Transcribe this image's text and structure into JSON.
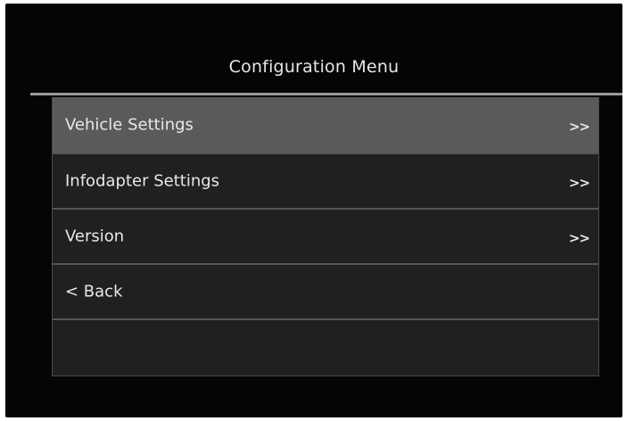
{
  "title": "Configuration Menu",
  "menu": {
    "items": [
      {
        "label": "Vehicle Settings",
        "arrow": ">>"
      },
      {
        "label": "Infodapter Settings",
        "arrow": ">>"
      },
      {
        "label": "Version",
        "arrow": ">>"
      },
      {
        "label": "< Back",
        "arrow": ""
      }
    ]
  },
  "colors": {
    "screen_background": "#050505",
    "row_background": "#202020",
    "selected_row_background": "#5a5a5a",
    "text": "#e8e8e8",
    "divider": "#555555"
  }
}
